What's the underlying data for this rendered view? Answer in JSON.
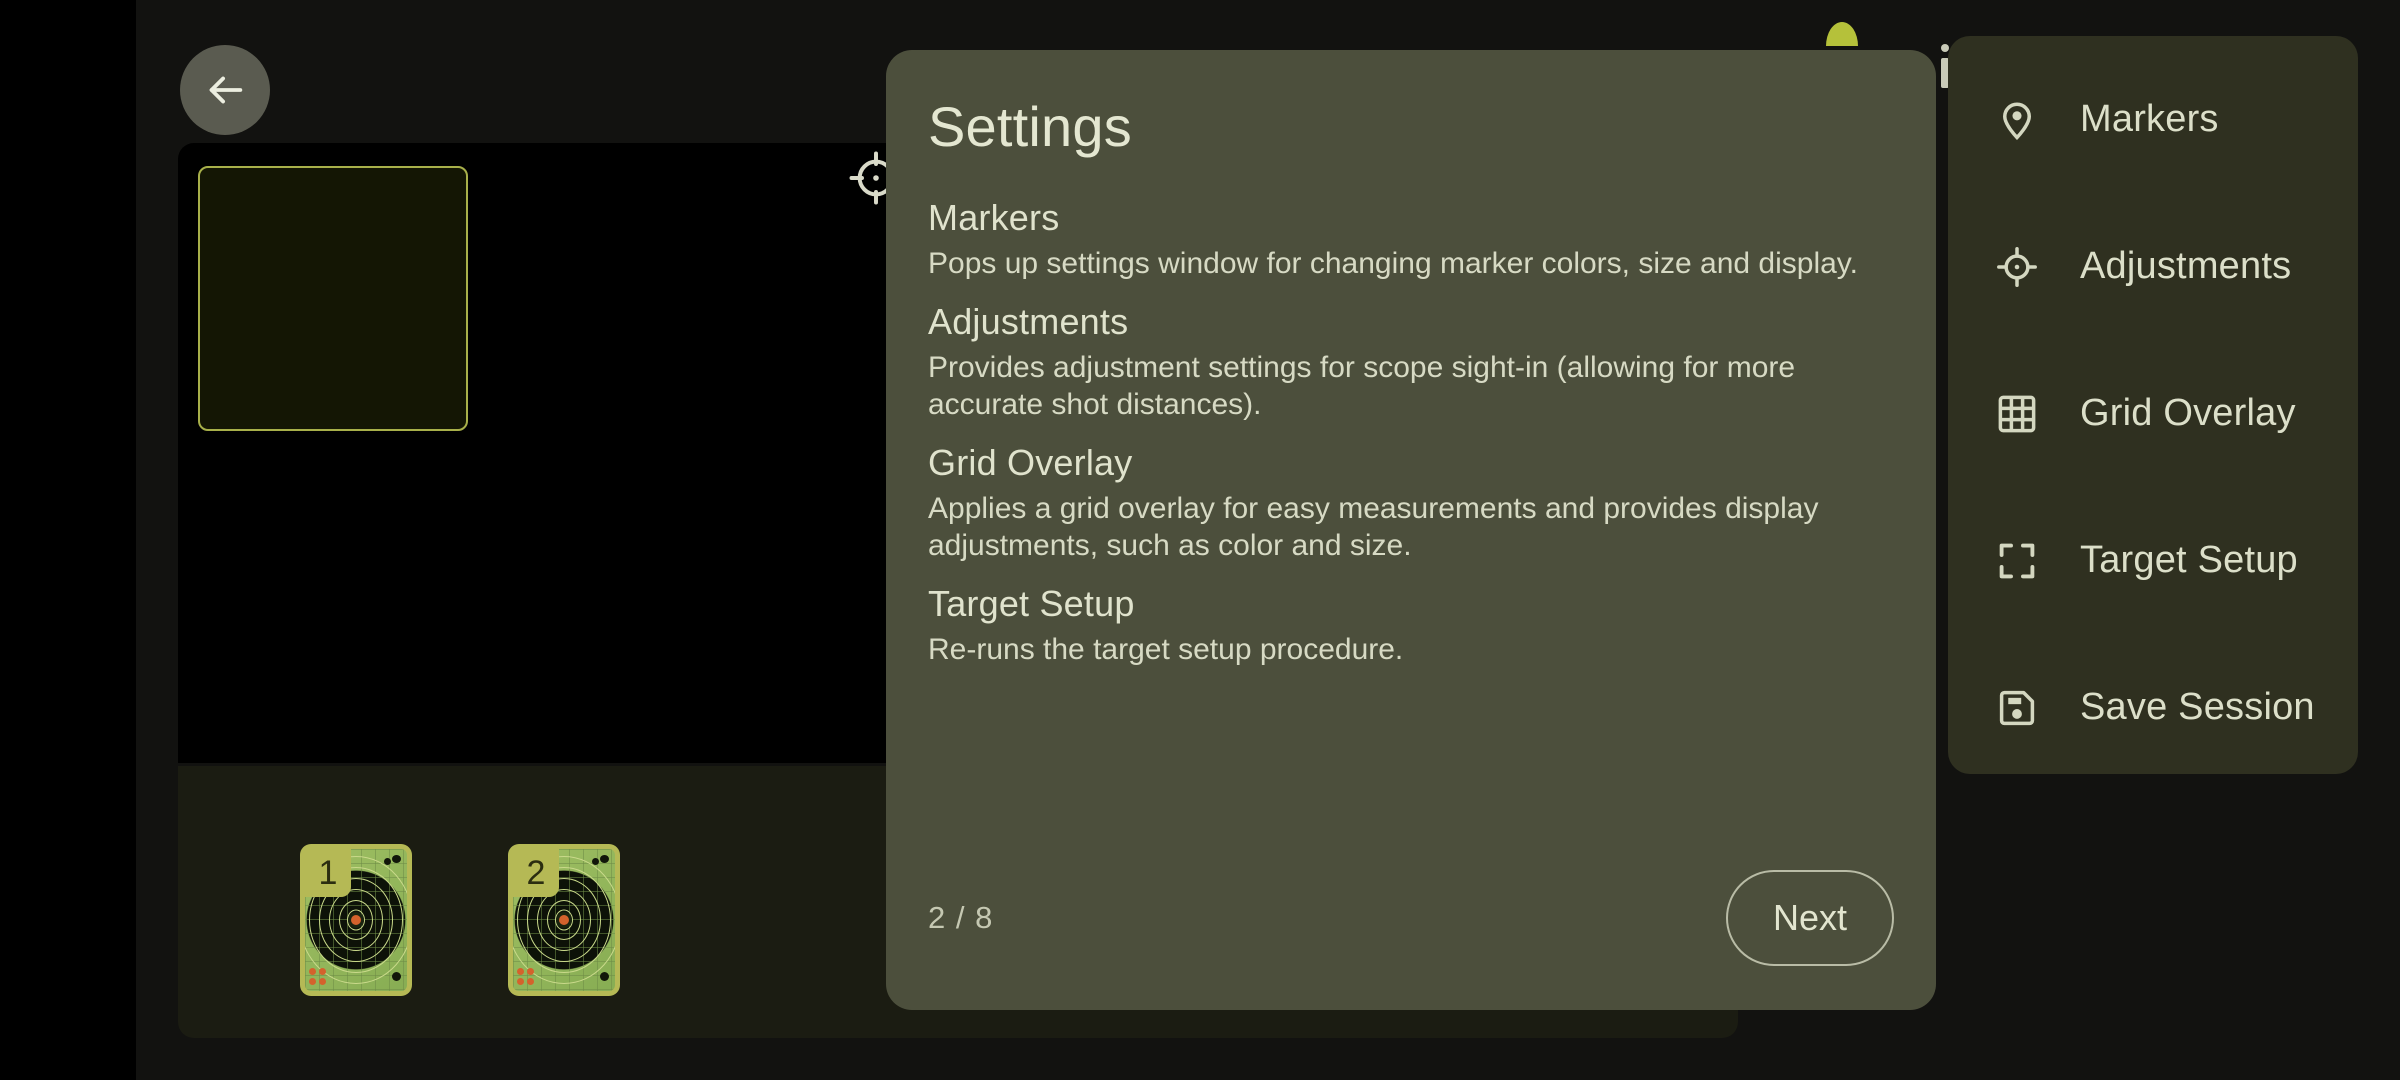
{
  "app": {
    "back_button_icon": "arrow-left-icon"
  },
  "viewer": {
    "selection_rect_color": "#a8b04a",
    "floating_crosshair_icon": "crosshair-icon"
  },
  "filmstrip": {
    "thumbnails": [
      {
        "number": "1",
        "name": "target-thumbnail-1"
      },
      {
        "number": "2",
        "name": "target-thumbnail-2"
      }
    ]
  },
  "side_menu": {
    "background_color": "#2f3020",
    "items": [
      {
        "label": "Markers",
        "icon": "map-pin-icon"
      },
      {
        "label": "Adjustments",
        "icon": "crosshair-icon"
      },
      {
        "label": "Grid Overlay",
        "icon": "grid-icon"
      },
      {
        "label": "Target Setup",
        "icon": "frame-corners-icon"
      },
      {
        "label": "Save Session",
        "icon": "floppy-disk-save-icon"
      }
    ]
  },
  "dialog": {
    "background_color": "#4c4f3c",
    "title": "Settings",
    "sections": [
      {
        "heading": "Markers",
        "body": "Pops up settings window for changing marker colors, size and display."
      },
      {
        "heading": "Adjustments",
        "body": "Provides adjustment settings for scope sight-in (allowing for more accurate shot distances)."
      },
      {
        "heading": "Grid Overlay",
        "body": "Applies a grid overlay for easy measurements and provides display adjustments, such as color and size."
      },
      {
        "heading": "Target Setup",
        "body": "Re-runs the target setup procedure."
      }
    ],
    "page_indicator": "2 / 8",
    "next_label": "Next"
  },
  "background_peek": {
    "teal_letter": "g"
  }
}
